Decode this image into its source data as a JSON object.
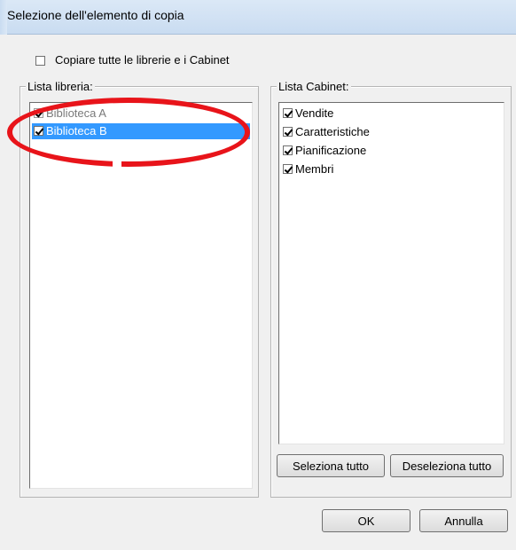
{
  "window": {
    "title": "Selezione dell'elemento di copia"
  },
  "copy_all": {
    "label": "Copiare tutte le librerie e i Cabinet",
    "checked": false
  },
  "library_list": {
    "legend": "Lista libreria:",
    "items": [
      {
        "label": "Biblioteca A",
        "checked": true,
        "selected": false
      },
      {
        "label": "Biblioteca B",
        "checked": true,
        "selected": true
      }
    ]
  },
  "cabinet_list": {
    "legend": "Lista Cabinet:",
    "items": [
      {
        "label": "Vendite",
        "checked": true
      },
      {
        "label": "Caratteristiche",
        "checked": true
      },
      {
        "label": "Pianificazione",
        "checked": true
      },
      {
        "label": "Membri",
        "checked": true
      }
    ]
  },
  "buttons": {
    "select_all": "Seleziona tutto",
    "deselect_all": "Deseleziona tutto",
    "ok": "OK",
    "cancel": "Annulla"
  },
  "colors": {
    "selection": "#3399ff",
    "annotation": "#e8141a"
  }
}
